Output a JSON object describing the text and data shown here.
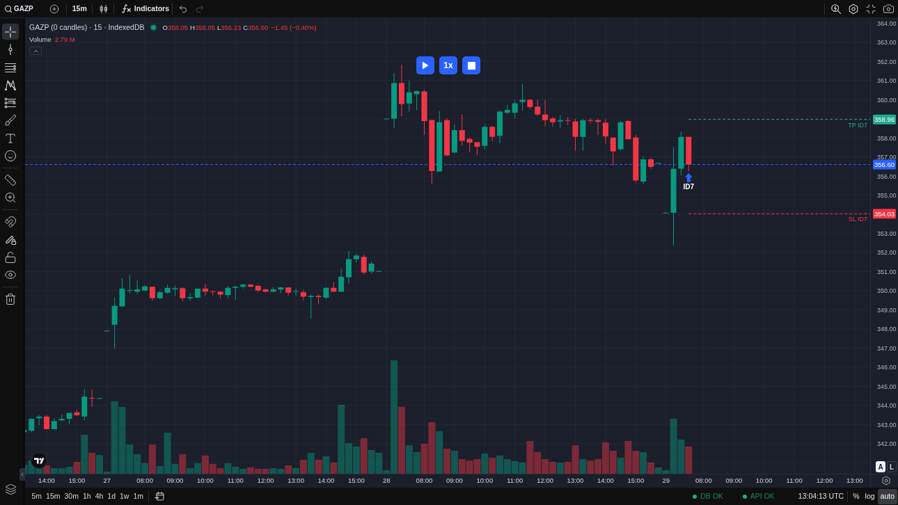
{
  "toolbar": {
    "symbol": "GAZP",
    "interval": "15m",
    "indicators": "Indicators",
    "undo_enabled": true,
    "redo_enabled": false
  },
  "drawing_tools": [
    {
      "tools": [
        {
          "kind": "crosshair",
          "selected": true
        },
        {
          "kind": "trend_line",
          "selected": false
        },
        {
          "kind": "fib",
          "selected": false
        },
        {
          "kind": "pattern",
          "selected": false
        },
        {
          "kind": "projection",
          "selected": false
        },
        {
          "kind": "brush",
          "selected": false
        },
        {
          "kind": "text",
          "selected": false
        },
        {
          "kind": "emoji",
          "selected": false
        }
      ]
    },
    {
      "tools": [
        {
          "kind": "ruler",
          "selected": false
        },
        {
          "kind": "zoom",
          "selected": false
        }
      ]
    },
    {
      "tools": [
        {
          "kind": "magnet",
          "selected": false
        },
        {
          "kind": "lock_drawings",
          "selected": false
        },
        {
          "kind": "lock",
          "selected": false
        },
        {
          "kind": "visibility",
          "selected": false
        }
      ]
    },
    {
      "tools": [
        {
          "kind": "trash",
          "selected": false
        }
      ]
    }
  ],
  "legend": {
    "title": "GAZP (0 candles) · 15 · IndexedDB",
    "live": true,
    "ohlc": [
      {
        "key": "O",
        "value": "358.05"
      },
      {
        "key": "H",
        "value": "358.05"
      },
      {
        "key": "L",
        "value": "356.23"
      },
      {
        "key": "C",
        "value": "356.60"
      }
    ],
    "change": "−1.45 (−0.40%)",
    "volume_label": "Volume",
    "volume_value": "2.79 M"
  },
  "replay": {
    "playing": false,
    "speed": "1x"
  },
  "chart_data": [
    {
      "type": "candlestick",
      "categories": [
        null,
        null,
        null,
        "14:00",
        null,
        null,
        null,
        "15:00",
        null,
        null,
        null,
        "27",
        null,
        null,
        null,
        null,
        "08:00",
        null,
        null,
        null,
        "09:00",
        null,
        null,
        null,
        "10:00",
        null,
        null,
        null,
        "11:00",
        null,
        null,
        null,
        "12:00",
        null,
        null,
        null,
        "13:00",
        null,
        null,
        null,
        "14:00",
        null,
        null,
        null,
        "15:00",
        null,
        null,
        null,
        "28",
        null,
        null,
        null,
        null,
        "08:00",
        null,
        null,
        null,
        "09:00",
        null,
        null,
        null,
        "10:00",
        null,
        null,
        null,
        "11:00",
        null,
        null,
        null,
        "12:00",
        null,
        null,
        null,
        "13:00",
        null,
        null,
        null,
        "14:00",
        null,
        null,
        null,
        "15:00",
        null,
        null,
        null,
        "29",
        null,
        null,
        null,
        null,
        "08:00",
        null,
        null,
        null,
        "09:00",
        null,
        null,
        null,
        "10:00",
        null,
        null,
        null,
        "11:00",
        null,
        null,
        null,
        "12:00",
        null,
        null,
        null,
        "13:00",
        null
      ],
      "ohlc": [
        [
          342.6,
          342.73,
          342.58,
          342.71
        ],
        [
          342.68,
          343.33,
          342.6,
          343.3
        ],
        [
          343.33,
          343.49,
          342.96,
          343.42
        ],
        [
          343.42,
          343.49,
          342.76,
          342.76
        ],
        [
          342.76,
          343.33,
          342.76,
          343.18
        ],
        [
          343.22,
          343.53,
          343.18,
          343.3
        ],
        [
          343.3,
          343.61,
          343.02,
          343.61
        ],
        [
          343.64,
          343.77,
          343.45,
          343.49
        ],
        [
          343.42,
          344.85,
          343.22,
          344.46
        ],
        [
          344.4,
          344.82,
          343.92,
          344.37
        ],
        [
          344.38,
          344.4,
          344.36,
          344.38
        ],
        [
          347.91,
          347.93,
          347.89,
          347.91
        ],
        [
          348.22,
          349.67,
          346.97,
          349.21
        ],
        [
          349.18,
          350.65,
          349.18,
          350.11
        ],
        [
          350.0,
          350.85,
          349.87,
          350.03
        ],
        [
          349.95,
          350.54,
          349.83,
          350.07
        ],
        [
          350.01,
          350.29,
          349.98,
          350.23
        ],
        [
          350.21,
          350.21,
          349.49,
          349.61
        ],
        [
          349.61,
          350.0,
          349.57,
          349.92
        ],
        [
          349.9,
          350.34,
          349.83,
          350.15
        ],
        [
          350.07,
          350.26,
          349.72,
          350.13
        ],
        [
          350.13,
          350.18,
          349.46,
          349.61
        ],
        [
          349.61,
          349.87,
          349.49,
          349.67
        ],
        [
          349.64,
          350.11,
          349.61,
          350.11
        ],
        [
          350.11,
          350.34,
          349.75,
          349.95
        ],
        [
          349.98,
          349.98,
          349.75,
          349.95
        ],
        [
          349.95,
          349.95,
          349.61,
          349.8
        ],
        [
          349.77,
          350.23,
          349.61,
          350.15
        ],
        [
          350.15,
          350.26,
          349.52,
          350.21
        ],
        [
          350.21,
          350.37,
          350.11,
          350.32
        ],
        [
          350.32,
          350.35,
          350.18,
          350.21
        ],
        [
          350.26,
          350.29,
          349.95,
          350.01
        ],
        [
          350.07,
          350.11,
          349.92,
          349.95
        ],
        [
          349.95,
          350.18,
          349.92,
          350.07
        ],
        [
          350.06,
          350.21,
          349.87,
          350.17
        ],
        [
          350.17,
          350.17,
          349.75,
          349.9
        ],
        [
          349.95,
          350.11,
          349.75,
          349.98
        ],
        [
          349.92,
          350.03,
          349.49,
          349.69
        ],
        [
          349.67,
          349.8,
          348.53,
          349.73
        ],
        [
          349.73,
          349.8,
          349.3,
          349.67
        ],
        [
          349.64,
          350.18,
          349.56,
          350.15
        ],
        [
          350.15,
          350.45,
          349.92,
          349.95
        ],
        [
          349.95,
          351.15,
          349.92,
          350.73
        ],
        [
          350.7,
          352.08,
          350.38,
          351.65
        ],
        [
          351.65,
          351.93,
          351.5,
          351.84
        ],
        [
          351.77,
          351.88,
          350.85,
          350.95
        ],
        [
          351.0,
          351.53,
          350.91,
          351.42
        ],
        [
          351.03,
          351.05,
          351.01,
          351.03
        ],
        [
          359.0,
          359.02,
          358.98,
          359.0
        ],
        [
          359.0,
          361.39,
          358.49,
          360.86
        ],
        [
          360.86,
          361.82,
          359.11,
          359.76
        ],
        [
          359.79,
          361.0,
          359.37,
          360.38
        ],
        [
          360.28,
          360.48,
          359.44,
          360.44
        ],
        [
          360.42,
          360.51,
          358.14,
          358.87
        ],
        [
          358.93,
          358.93,
          355.6,
          356.26
        ],
        [
          356.23,
          359.4,
          356.23,
          358.81
        ],
        [
          358.92,
          359.01,
          357.03,
          357.08
        ],
        [
          357.23,
          358.7,
          357.19,
          358.4
        ],
        [
          358.4,
          359.22,
          357.59,
          357.84
        ],
        [
          357.94,
          358.01,
          357.23,
          357.75
        ],
        [
          357.77,
          357.77,
          357.1,
          357.53
        ],
        [
          357.58,
          358.7,
          357.4,
          358.57
        ],
        [
          358.57,
          358.64,
          357.81,
          358.05
        ],
        [
          358.1,
          359.44,
          357.71,
          359.37
        ],
        [
          359.31,
          359.72,
          359.22,
          359.46
        ],
        [
          359.31,
          359.96,
          359.02,
          359.8
        ],
        [
          359.87,
          360.8,
          359.41,
          359.99
        ],
        [
          359.99,
          360.03,
          359.5,
          359.61
        ],
        [
          359.63,
          359.99,
          359.14,
          359.22
        ],
        [
          359.22,
          359.99,
          358.59,
          358.92
        ],
        [
          359.01,
          359.09,
          358.59,
          358.81
        ],
        [
          358.85,
          359.18,
          358.53,
          358.92
        ],
        [
          358.92,
          359.09,
          358.66,
          358.9
        ],
        [
          358.85,
          358.98,
          357.32,
          358.05
        ],
        [
          358.05,
          358.98,
          357.32,
          358.92
        ],
        [
          358.92,
          359.01,
          358.75,
          358.9
        ],
        [
          358.92,
          358.98,
          358.14,
          358.83
        ],
        [
          358.79,
          358.98,
          357.68,
          358.07
        ],
        [
          358.01,
          358.01,
          356.54,
          357.29
        ],
        [
          357.4,
          358.88,
          357.32,
          358.81
        ],
        [
          358.88,
          358.92,
          357.92,
          357.92
        ],
        [
          358.01,
          358.14,
          355.66,
          355.77
        ],
        [
          355.71,
          357.03,
          355.6,
          356.87
        ],
        [
          356.87,
          356.97,
          356.38,
          356.48
        ],
        [
          356.69,
          356.71,
          356.67,
          356.69
        ],
        [
          354.08,
          354.1,
          354.06,
          354.08
        ],
        [
          354.08,
          357.53,
          352.35,
          356.38
        ],
        [
          356.38,
          358.33,
          356.02,
          358.05
        ],
        [
          358.05,
          358.05,
          356.23,
          356.6
        ],
        null,
        null,
        null,
        null,
        null,
        null,
        null,
        null,
        null,
        null,
        null,
        null,
        null,
        null,
        null,
        null,
        null,
        null,
        null,
        null,
        null,
        null,
        null
      ],
      "ylim": [
        340.43,
        364.26
      ],
      "yticks": [
        {
          "value": 364,
          "label": "364.00"
        },
        {
          "value": 363,
          "label": "363.00"
        },
        {
          "value": 362,
          "label": "362.00"
        },
        {
          "value": 361,
          "label": "361.00"
        },
        {
          "value": 360,
          "label": "360.00"
        },
        {
          "value": 358,
          "label": "358.00"
        },
        {
          "value": 357,
          "label": "357.00"
        },
        {
          "value": 356,
          "label": "356.00"
        },
        {
          "value": 355,
          "label": "355.00"
        },
        {
          "value": 353,
          "label": "353.00"
        },
        {
          "value": 352,
          "label": "352.00"
        },
        {
          "value": 351,
          "label": "351.00"
        },
        {
          "value": 350,
          "label": "350.00"
        },
        {
          "value": 349,
          "label": "349.00"
        },
        {
          "value": 348,
          "label": "348.00"
        },
        {
          "value": 347,
          "label": "347.00"
        },
        {
          "value": 346,
          "label": "346.00"
        },
        {
          "value": 345,
          "label": "345.00"
        },
        {
          "value": 344,
          "label": "344.00"
        },
        {
          "value": 343,
          "label": "343.00"
        },
        {
          "value": 342,
          "label": "342.00"
        }
      ],
      "grid": true,
      "ref_lines": [
        {
          "axis": "y",
          "value": 358.96,
          "label": "TP ID7",
          "color": "#22ab94",
          "line_style": "dashed"
        },
        {
          "axis": "y",
          "value": 356.6,
          "color": "#2962ff",
          "line_style": "dashed"
        },
        {
          "axis": "y",
          "value": 354.03,
          "label": "SL ID7",
          "color": "#f23645",
          "line_style": "dashed"
        }
      ],
      "annotations": [
        "ID7"
      ]
    }
  ],
  "price_scale": {
    "tags": [
      "358.96",
      "356.60",
      "354.03"
    ],
    "modes": [
      {
        "label": "A",
        "selected": true
      },
      {
        "label": "L",
        "selected": false
      }
    ]
  },
  "timeframes": [
    {
      "label": "5m",
      "selected": false
    },
    {
      "label": "15m",
      "selected": false
    },
    {
      "label": "30m",
      "selected": false
    },
    {
      "label": "1h",
      "selected": false
    },
    {
      "label": "4h",
      "selected": false
    },
    {
      "label": "1d",
      "selected": false
    },
    {
      "label": "1w",
      "selected": false
    },
    {
      "label": "1m",
      "selected": false
    }
  ],
  "status": [
    {
      "label": "DB OK",
      "ok": true
    },
    {
      "label": "API OK",
      "ok": true
    }
  ],
  "clock": "13:04:13 UTC",
  "scale_modes": [
    {
      "label": "%",
      "selected": false
    },
    {
      "label": "log",
      "selected": false
    },
    {
      "label": "auto",
      "selected": true
    }
  ]
}
